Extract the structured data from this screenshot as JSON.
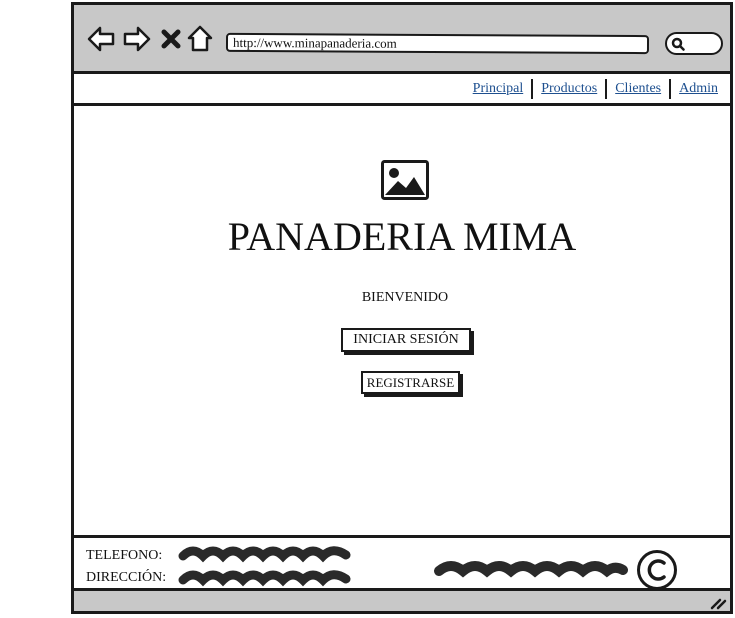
{
  "browser": {
    "url": "http://www.minapanaderia.com"
  },
  "nav": {
    "items": [
      "Principal",
      "Productos",
      "Clientes",
      "Admin"
    ]
  },
  "main": {
    "title": "PANADERIA MIMA",
    "welcome": "BIENVENIDO",
    "login_label": "INICIAR SESIÓN",
    "register_label": "REGISTRARSE"
  },
  "footer": {
    "phone_label": "TELEFONO:",
    "address_label": "DIRECCIÓN:",
    "copyright_symbol": "©"
  },
  "icons": {
    "back": "back-arrow-icon",
    "forward": "forward-arrow-icon",
    "stop": "close-icon",
    "home": "home-icon",
    "search": "search-icon",
    "logo": "image-placeholder-icon",
    "resize": "resize-grip-icon"
  },
  "colors": {
    "chrome": "#c8c8c8",
    "link": "#1d4f8f",
    "ink": "#1a1a1a"
  }
}
